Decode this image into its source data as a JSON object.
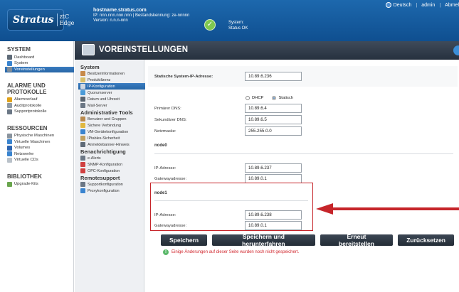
{
  "header": {
    "logo_main": "Stratus",
    "logo_sub": "ztC Edge",
    "hostname": "hostname.stratus.com",
    "ip_line": "IP: nnn.nnn.nnn.nnn | Bestandskennung: ze-nnnnn",
    "version": "Version: n.n.n-nnn",
    "status_label": "System:",
    "status_value": "Status OK",
    "language": "Deutsch",
    "user": "admin",
    "logout": "Abmel"
  },
  "page_title": "VOREINSTELLUNGEN",
  "leftnav": {
    "sections": [
      {
        "title": "SYSTEM",
        "items": [
          {
            "label": "Dashboard",
            "icon": "dashboard-icon",
            "active": false
          },
          {
            "label": "System",
            "icon": "system-icon",
            "active": false
          },
          {
            "label": "Voreinstellungen",
            "icon": "preferences-icon",
            "active": true
          }
        ]
      },
      {
        "title": "ALARME UND PROTOKOLLE",
        "items": [
          {
            "label": "Alarmverlauf",
            "icon": "alarm-icon",
            "active": false
          },
          {
            "label": "Auditprotokolle",
            "icon": "audit-icon",
            "active": false
          },
          {
            "label": "Supportprotokolle",
            "icon": "support-log-icon",
            "active": false
          }
        ]
      },
      {
        "title": "RESSOURCEN",
        "items": [
          {
            "label": "Physische Maschinen",
            "icon": "physical-machine-icon",
            "active": false
          },
          {
            "label": "Virtuelle Maschinen",
            "icon": "vm-icon",
            "active": false
          },
          {
            "label": "Volumes",
            "icon": "volume-icon",
            "active": false
          },
          {
            "label": "Netzwerke",
            "icon": "network-icon",
            "active": false
          },
          {
            "label": "Virtuelle CDs",
            "icon": "cd-icon",
            "active": false
          }
        ]
      },
      {
        "title": "BIBLIOTHEK",
        "items": [
          {
            "label": "Upgrade-Kits",
            "icon": "upgrade-kit-icon",
            "active": false
          }
        ]
      }
    ]
  },
  "subnav": {
    "sections": [
      {
        "title": "System",
        "items": [
          {
            "label": "Besitzerinformationen",
            "icon": "owner-icon",
            "active": false
          },
          {
            "label": "Produktlizenz",
            "icon": "license-icon",
            "active": false
          },
          {
            "label": "IP-Konfiguration",
            "icon": "ip-config-icon",
            "active": true
          },
          {
            "label": "Quorumserver",
            "icon": "quorum-icon",
            "active": false
          },
          {
            "label": "Datum und Uhrzeit",
            "icon": "clock-icon",
            "active": false
          },
          {
            "label": "Mail-Server",
            "icon": "mail-icon",
            "active": false
          }
        ]
      },
      {
        "title": "Administrative Tools",
        "items": [
          {
            "label": "Benutzer und Gruppen",
            "icon": "users-icon",
            "active": false
          },
          {
            "label": "Sichere Verbindung",
            "icon": "lock-icon",
            "active": false
          },
          {
            "label": "VM-Gerätekonfiguration",
            "icon": "vm-device-icon",
            "active": false
          },
          {
            "label": "IPtables-Sicherheit",
            "icon": "iptables-icon",
            "active": false
          },
          {
            "label": "Anmeldebanner-Hinweis",
            "icon": "banner-icon",
            "active": false
          }
        ]
      },
      {
        "title": "Benachrichtigung",
        "items": [
          {
            "label": "e-Alerts",
            "icon": "ealert-icon",
            "active": false
          },
          {
            "label": "SNMP-Konfiguration",
            "icon": "snmp-icon",
            "active": false
          },
          {
            "label": "OPC-Konfiguration",
            "icon": "opc-icon",
            "active": false
          }
        ]
      },
      {
        "title": "Remotesupport",
        "items": [
          {
            "label": "Supportkonfiguration",
            "icon": "support-config-icon",
            "active": false
          },
          {
            "label": "Proxykonfiguration",
            "icon": "proxy-icon",
            "active": false
          }
        ]
      }
    ]
  },
  "form": {
    "static_ip_label": "Statische System-IP-Adresse:",
    "static_ip_value": "10.89.6.236",
    "dhcp_label": "DHCP",
    "static_label": "Statisch",
    "primary_dns_label": "Primärer DNS:",
    "primary_dns_value": "10.89.6.4",
    "secondary_dns_label": "Sekundärer DNS:",
    "secondary_dns_value": "10.89.6.5",
    "netmask_label": "Netzmaske:",
    "netmask_value": "255.255.0.0",
    "node0_title": "node0",
    "node0_ip_label": "IP-Adresse:",
    "node0_ip_value": "10.89.6.237",
    "node0_gw_label": "Gatewayadresse:",
    "node0_gw_value": "10.89.0.1",
    "node1_title": "node1",
    "node1_ip_label": "IP-Adresse:",
    "node1_ip_value": "10.89.6.238",
    "node1_gw_label": "Gatewayadresse:",
    "node1_gw_value": "10.89.0.1"
  },
  "buttons": {
    "save": "Speichern",
    "save_shutdown": "Speichern und herunterfahren",
    "redeploy": "Erneut bereitstellen",
    "reset": "Zurücksetzen"
  },
  "warning": "Einige Änderungen auf dieser Seite wurden noch nicht gespeichert.",
  "colors": {
    "header": "#1d68ad",
    "active": "#2d6fb2",
    "highlight": "#c6252a",
    "warning": "#d0242b"
  }
}
